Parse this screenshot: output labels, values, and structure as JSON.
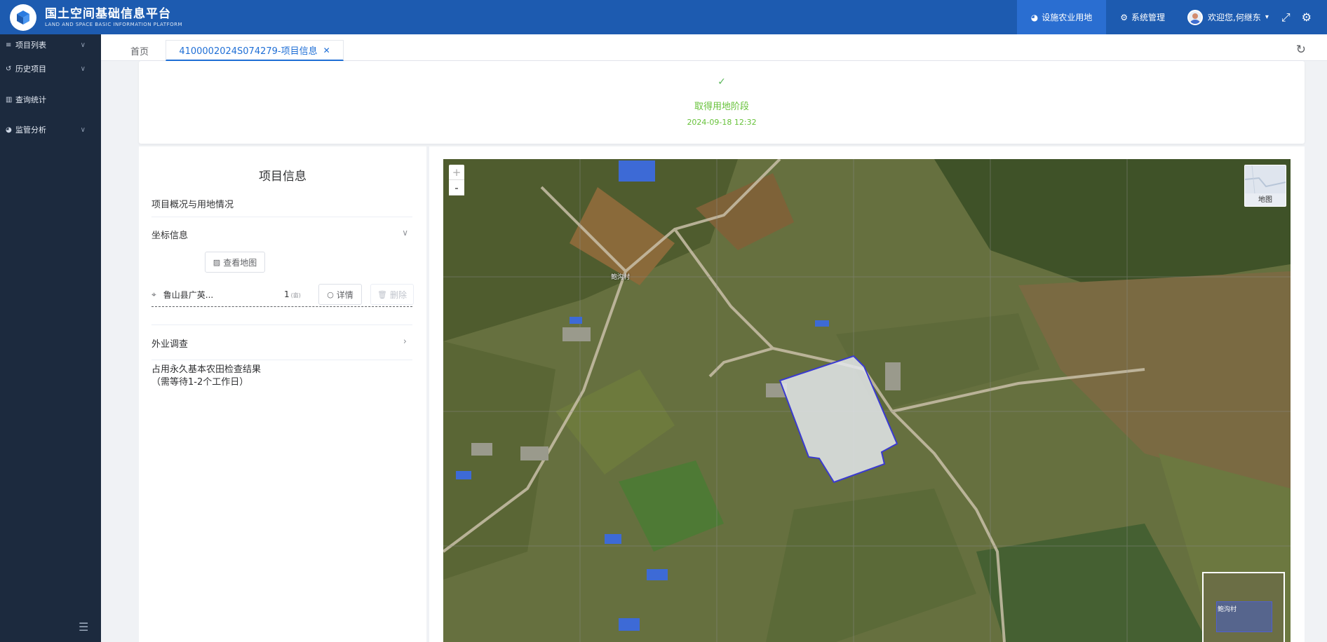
{
  "header": {
    "title": "国土空间基础信息平台",
    "subtitle": "LAND AND SPACE BASIC INFORMATION PLATFORM",
    "nav_active": "设施农业用地",
    "nav_system": "系统管理",
    "user_greeting": "欢迎您,何继东",
    "icons": [
      "pie-chart-icon",
      "gears-icon",
      "chevron-down-icon",
      "fullscreen-icon",
      "settings-icon"
    ]
  },
  "sidebar": {
    "items": [
      {
        "label": "项目列表",
        "icon": "list-icon"
      },
      {
        "label": "历史项目",
        "icon": "history-icon"
      },
      {
        "label": "查询统计",
        "icon": "bar-chart-icon"
      },
      {
        "label": "监管分析",
        "icon": "pie-chart-icon"
      }
    ]
  },
  "tabs": {
    "home": "首页",
    "active": "4100002024S074279-项目信息"
  },
  "stage": {
    "name": "取得用地阶段",
    "time": "2024-09-18 12:32",
    "color": "#67c23a"
  },
  "info": {
    "title": "项目信息",
    "subtitle": "项目概况与用地情况",
    "coord_header": "坐标信息",
    "view_map": "查看地图",
    "location": "鲁山县广英...",
    "count": "1",
    "count_unit": "(亩)",
    "detail": "详情",
    "delete": "删除",
    "survey": "外业调查",
    "result_line1": "占用永久基本农田检查结果",
    "result_line2": "（需等待1-2个工作日）"
  },
  "map": {
    "zoom_in": "+",
    "zoom_out": "-",
    "layer_label": "地图",
    "village_label": "鲍沟村",
    "polygon_color": "#3a3ad0"
  }
}
